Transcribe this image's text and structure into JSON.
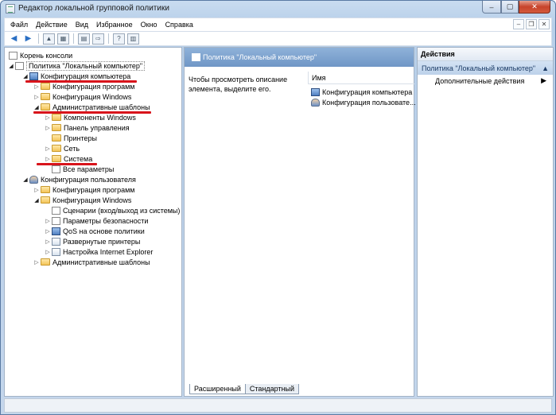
{
  "window": {
    "title": "Редактор локальной групповой политики"
  },
  "window_controls": {
    "minimize": "–",
    "maximize": "▢",
    "close": "✕"
  },
  "menu": {
    "items": [
      "Файл",
      "Действие",
      "Вид",
      "Избранное",
      "Окно",
      "Справка"
    ]
  },
  "tree": {
    "root": "Корень консоли",
    "policy": "Политика \"Локальный компьютер\"",
    "computer_config": "Конфигурация компьютера",
    "software_settings": "Конфигурация программ",
    "windows_settings": "Конфигурация Windows",
    "admin_templates": "Административные шаблоны",
    "windows_components": "Компоненты Windows",
    "control_panel": "Панель управления",
    "printers": "Принтеры",
    "network": "Сеть",
    "system": "Система",
    "all_settings": "Все параметры",
    "user_config": "Конфигурация пользователя",
    "user_software": "Конфигурация программ",
    "user_windows": "Конфигурация Windows",
    "scripts": "Сценарии (вход/выход из системы)",
    "security": "Параметры безопасности",
    "qos": "QoS на основе политики",
    "deployed_printers": "Развернутые принтеры",
    "ie": "Настройка Internet Explorer",
    "user_admin_templates": "Административные шаблоны"
  },
  "middle": {
    "header": "Политика \"Локальный компьютер\"",
    "hint": "Чтобы просмотреть описание элемента, выделите его.",
    "column_name": "Имя",
    "items": [
      "Конфигурация компьютера",
      "Конфигурация пользовате..."
    ],
    "tabs": [
      "Расширенный",
      "Стандартный"
    ]
  },
  "actions": {
    "title": "Действия",
    "group": "Политика \"Локальный компьютер\"",
    "more": "Дополнительные действия"
  },
  "colors": {
    "highlight_red": "#d8141b",
    "header_blue": "#7aa0cc"
  }
}
